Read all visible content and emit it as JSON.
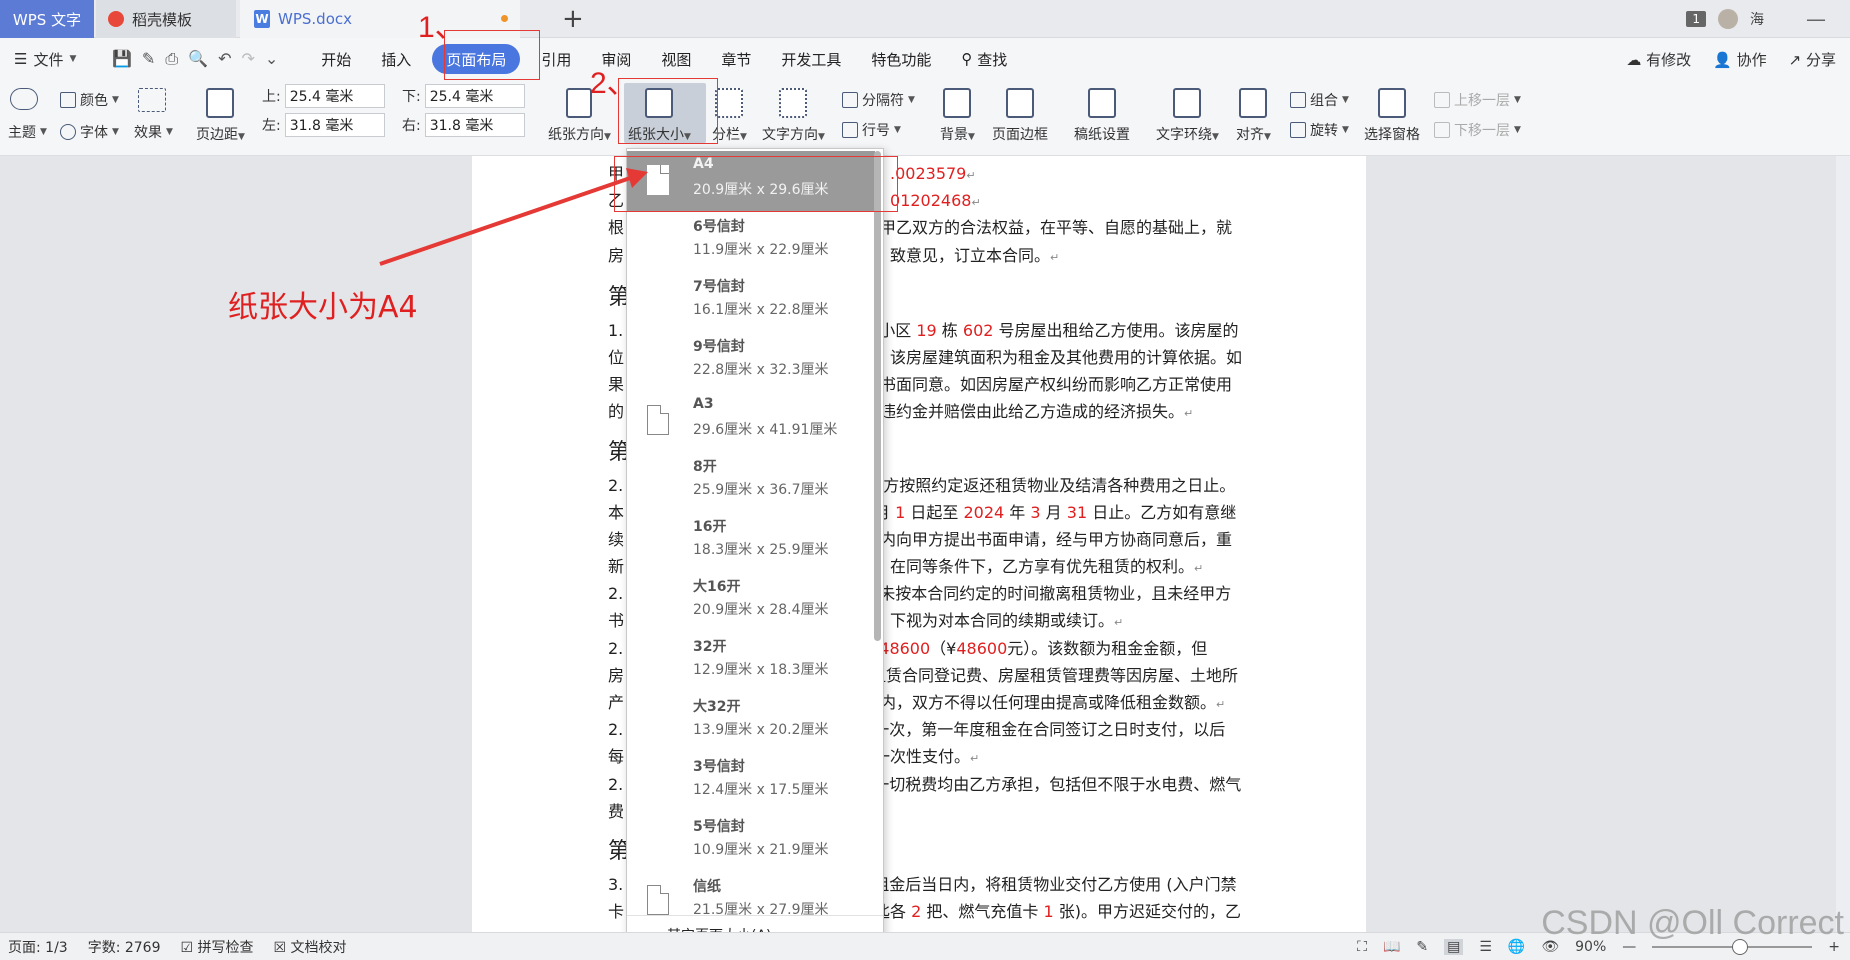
{
  "titlebar": {
    "app_tab": "WPS 文字",
    "template_tab": "稻壳模板",
    "doc_tab": "WPS.docx",
    "new_tab": "+",
    "window_count": "1",
    "user": "海",
    "minimize": "—"
  },
  "menu": {
    "file": "文件",
    "items": [
      "开始",
      "插入",
      "页面布局",
      "引用",
      "审阅",
      "视图",
      "章节",
      "开发工具",
      "特色功能",
      "查找"
    ],
    "active": "页面布局",
    "right": [
      "有修改",
      "协作",
      "分享"
    ]
  },
  "ribbon": {
    "theme": "主题",
    "color": "颜色",
    "font": "字体",
    "effect": "效果",
    "margins": "页边距",
    "top_label": "上:",
    "top_value": "25.4 毫米",
    "bottom_label": "下:",
    "bottom_value": "25.4 毫米",
    "left_label": "左:",
    "left_value": "31.8 毫米",
    "right_label": "右:",
    "right_value": "31.8 毫米",
    "orientation": "纸张方向",
    "paper_size": "纸张大小",
    "columns": "分栏",
    "text_direction": "文字方向",
    "breaks": "分隔符",
    "line_numbers": "行号",
    "background": "背景",
    "page_border": "页面边框",
    "manuscript": "稿纸设置",
    "text_wrap": "文字环绕",
    "align": "对齐",
    "group": "组合",
    "rotate": "旋转",
    "selection_pane": "选择窗格",
    "bring_forward": "上移一层",
    "send_backward": "下移一层"
  },
  "annotations": {
    "step1": "1、",
    "step2": "2、",
    "note": "纸张大小为A4"
  },
  "document": {
    "lines": [
      {
        "a": "甲",
        "b": ".0023579",
        "c": ""
      },
      {
        "a": "乙",
        "b": "01202468",
        "c": ""
      },
      {
        "a": "根",
        "b": "",
        "c": "甲乙双方的合法权益，在平等、自愿的基础上，就"
      },
      {
        "a": "房",
        "b": "",
        "c": "致意见，订立本合同。"
      }
    ],
    "heading1": "第",
    "p1": [
      {
        "a": "1.",
        "rest": "小区 ",
        "r1": "19",
        "m": " 栋 ",
        "r2": "602",
        "tail": " 号房屋出租给乙方使用。该房屋的"
      },
      {
        "a": "位",
        "rest": "该房屋建筑面积为租金及其他费用的计算依据。如"
      },
      {
        "a": "果",
        "rest": "书面同意。如因房屋产权纠纷而影响乙方正常使用"
      },
      {
        "a": "的",
        "rest": "违约金并赔偿由此给乙方造成的经济损失。"
      }
    ],
    "heading2": "第",
    "p2": [
      {
        "a": "2.",
        "rest": "乙方按照约定返还租赁物业及结清各种费用之日止。"
      },
      {
        "a": "本",
        "rest": "月 ",
        "r1": "1",
        "m": " 日起至 ",
        "r2": "2024",
        "m2": " 年 ",
        "r3": "3",
        "m3": " 月 ",
        "r4": "31",
        "tail": " 日止。乙方如有意继"
      },
      {
        "a": "续",
        "rest": "内向甲方提出书面申请，经与甲方协商同意后，重"
      },
      {
        "a": "新",
        "rest": "在同等条件下，乙方享有优先租赁的权利。"
      },
      {
        "a": "2.",
        "rest": "未按本合同约定的时间撤离租赁物业，且未经甲方"
      },
      {
        "a": "书",
        "rest": "下视为对本合同的续期或续订。"
      },
      {
        "a": "2.",
        "rest": "",
        "r1": "48600",
        "m": "（¥",
        "r2": "48600",
        "tail": "元）。该数额为租金金额，但"
      },
      {
        "a": "房",
        "rest": "租赁合同登记费、房屋租赁管理费等因房屋、土地所"
      },
      {
        "a": "产",
        "rest": "内，双方不得以任何理由提高或降低租金数额。"
      },
      {
        "a": "2.",
        "rest": "一次，第一年度租金在合同签订之日时支付，以后"
      },
      {
        "a": "每",
        "rest": "一次性支付。"
      },
      {
        "a": "2.",
        "rest": "一切税费均由乙方承担，包括但不限于水电费、燃气"
      },
      {
        "a": "费",
        "rest": ""
      }
    ],
    "heading3": "第",
    "p3": [
      {
        "a": "3.",
        "rest": "租金后当日内，将租赁物业交付乙方使用 (入户门禁"
      },
      {
        "a": "卡",
        "rest": "匙各 ",
        "r1": "2",
        "m": " 把、燃气充值卡 ",
        "r2": "1",
        "tail": " 张)。甲方迟延交付的，乙"
      }
    ]
  },
  "paper_menu": {
    "items": [
      {
        "name": "A4",
        "size": "20.9厘米 x 29.6厘米",
        "icon": "page-icon"
      },
      {
        "name": "6号信封",
        "size": "11.9厘米 x 22.9厘米",
        "icon": ""
      },
      {
        "name": "7号信封",
        "size": "16.1厘米 x 22.8厘米",
        "icon": ""
      },
      {
        "name": "9号信封",
        "size": "22.8厘米 x 32.3厘米",
        "icon": ""
      },
      {
        "name": "A3",
        "size": "29.6厘米 x 41.91厘米",
        "icon": "page-icon"
      },
      {
        "name": "8开",
        "size": "25.9厘米 x 36.7厘米",
        "icon": ""
      },
      {
        "name": "16开",
        "size": "18.3厘米 x 25.9厘米",
        "icon": ""
      },
      {
        "name": "大16开",
        "size": "20.9厘米 x 28.4厘米",
        "icon": ""
      },
      {
        "name": "32开",
        "size": "12.9厘米 x 18.3厘米",
        "icon": ""
      },
      {
        "name": "大32开",
        "size": "13.9厘米 x 20.2厘米",
        "icon": ""
      },
      {
        "name": "3号信封",
        "size": "12.4厘米 x 17.5厘米",
        "icon": ""
      },
      {
        "name": "5号信封",
        "size": "10.9厘米 x 21.9厘米",
        "icon": ""
      },
      {
        "name": "信纸",
        "size": "21.5厘米 x 27.9厘米",
        "icon": "page-icon"
      }
    ],
    "selected": "A4",
    "more": "其它页面大小(A)..."
  },
  "status": {
    "page": "页面: 1/3",
    "words": "字数: 2769",
    "spell": "拼写检查",
    "proof": "文档校对",
    "zoom": "90%",
    "zoom_fraction": 0.55
  },
  "watermark": "CSDN @Oll Correct"
}
